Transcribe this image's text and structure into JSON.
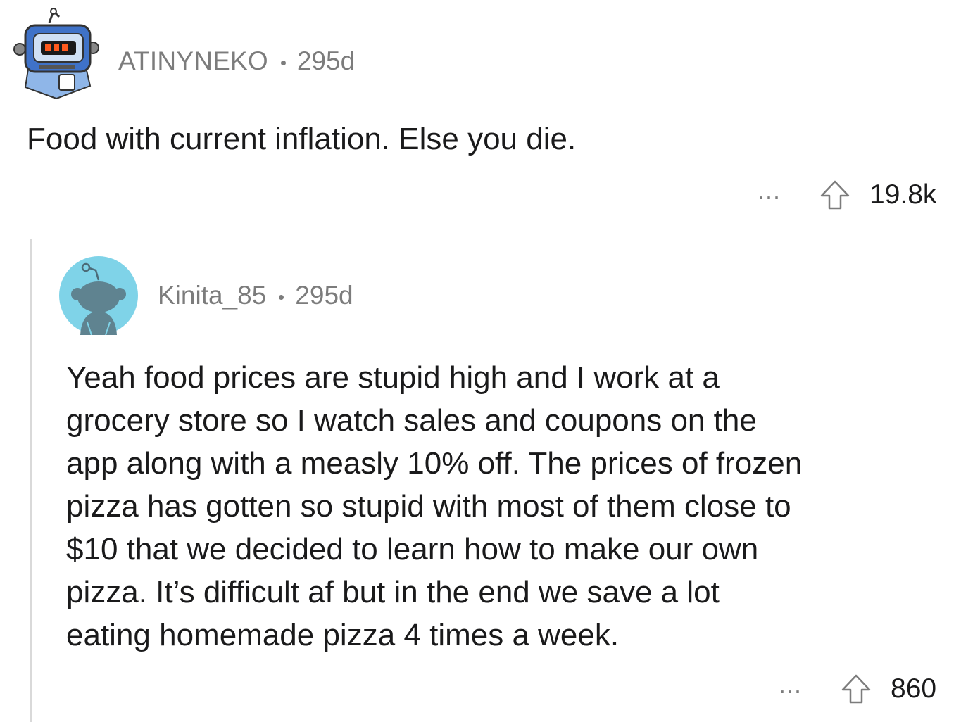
{
  "comment": {
    "username": "ATINYNEKO",
    "age": "295d",
    "body": "Food with current inflation. Else you die.",
    "more": "...",
    "score": "19.8k",
    "avatar_icon": "robot-snoo-avatar-icon",
    "upvote_icon": "upvote-arrow-icon"
  },
  "reply": {
    "username": "Kinita_85",
    "age": "295d",
    "body_lines": [
      "Yeah food prices are stupid high and I work at a",
      "grocery store so I watch sales and coupons on the",
      "app along with a measly 10% off. The prices of frozen",
      "pizza has gotten so stupid with most of them close to",
      "$10 that we decided to learn how to make our own",
      "pizza. It’s difficult af but in the end we save a lot",
      "eating homemade pizza 4 times a week."
    ],
    "more": "...",
    "score": "860",
    "avatar_icon": "default-snoo-avatar-icon",
    "upvote_icon": "upvote-arrow-icon"
  },
  "colors": {
    "meta_text": "#7c7c7c",
    "body_text": "#1a1a1b",
    "thread_line": "#d9d9d9",
    "reply_avatar_bg": "#7fd3e8",
    "robot_blue": "#3f72c8"
  }
}
